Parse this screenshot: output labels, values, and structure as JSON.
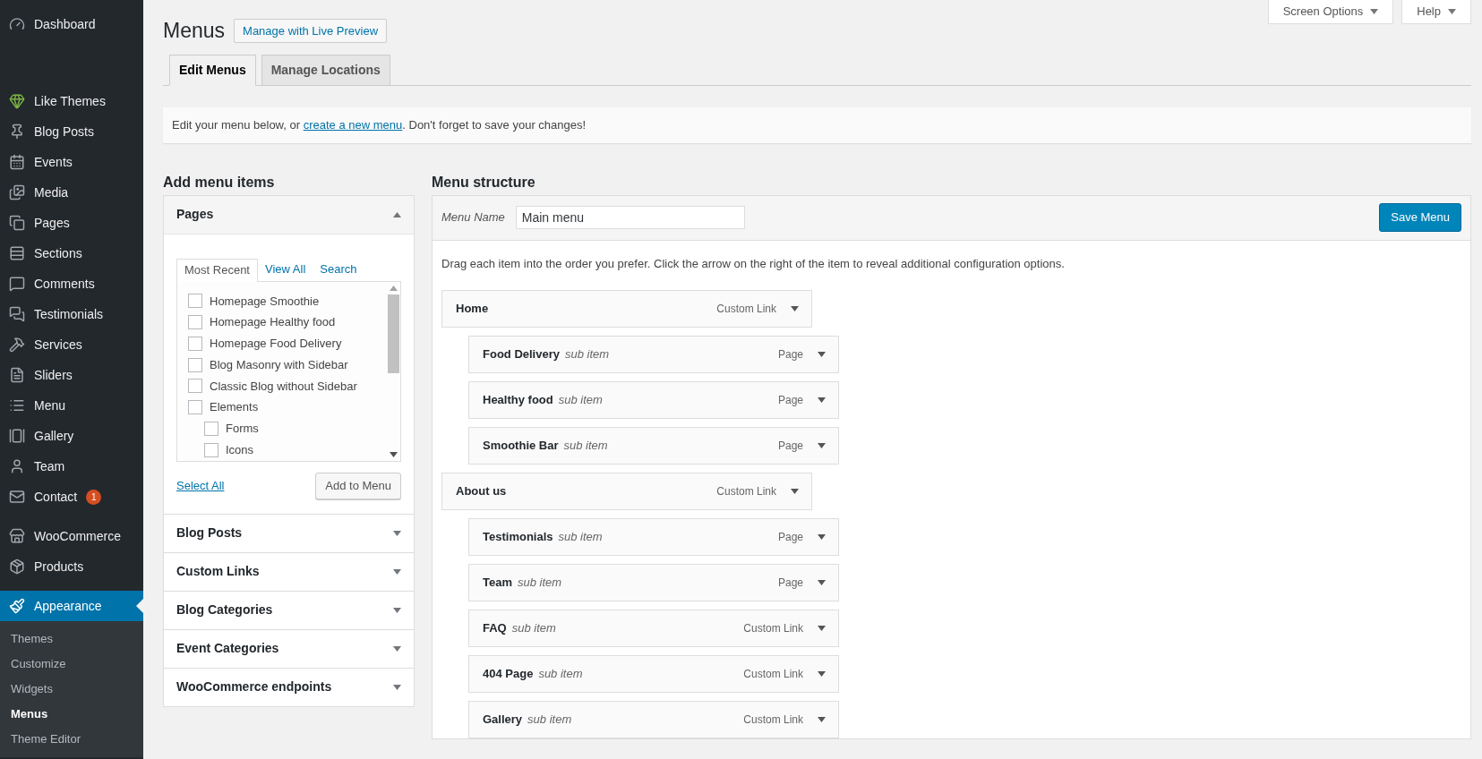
{
  "sidebar": {
    "items": [
      {
        "label": "Dashboard",
        "selected": false
      },
      {
        "label": "Like Themes",
        "selected": false
      },
      {
        "label": "Blog Posts",
        "selected": false
      },
      {
        "label": "Events",
        "selected": false
      },
      {
        "label": "Media",
        "selected": false
      },
      {
        "label": "Pages",
        "selected": false
      },
      {
        "label": "Sections",
        "selected": false
      },
      {
        "label": "Comments",
        "selected": false
      },
      {
        "label": "Testimonials",
        "selected": false
      },
      {
        "label": "Services",
        "selected": false
      },
      {
        "label": "Sliders",
        "selected": false
      },
      {
        "label": "Menu",
        "selected": false
      },
      {
        "label": "Gallery",
        "selected": false
      },
      {
        "label": "Team",
        "selected": false
      },
      {
        "label": "Contact",
        "selected": false,
        "badge": "1"
      },
      {
        "label": "WooCommerce",
        "selected": false
      },
      {
        "label": "Products",
        "selected": false
      },
      {
        "label": "Appearance",
        "selected": true,
        "children": [
          {
            "label": "Themes",
            "selected": false
          },
          {
            "label": "Customize",
            "selected": false
          },
          {
            "label": "Widgets",
            "selected": false
          },
          {
            "label": "Menus",
            "selected": true
          },
          {
            "label": "Theme Editor",
            "selected": false
          }
        ]
      }
    ]
  },
  "header": {
    "title": "Menus",
    "live_preview_button": "Manage with Live Preview",
    "screen_options": "Screen Options",
    "help": "Help"
  },
  "tabs": [
    {
      "label": "Edit Menus",
      "selected": true
    },
    {
      "label": "Manage Locations",
      "selected": false
    }
  ],
  "notice": {
    "before": "Edit your menu below, or ",
    "link": "create a new menu",
    "after": ". Don't forget to save your changes!"
  },
  "add_items": {
    "heading": "Add menu items",
    "panels": [
      {
        "title": "Pages",
        "expanded": true,
        "tabs": [
          {
            "label": "Most Recent",
            "selected": true
          },
          {
            "label": "View All",
            "selected": false
          },
          {
            "label": "Search",
            "selected": false
          }
        ],
        "pages": [
          {
            "label": "Homepage Smoothie",
            "checked": false
          },
          {
            "label": "Homepage Healthy food",
            "checked": false
          },
          {
            "label": "Homepage Food Delivery",
            "checked": false
          },
          {
            "label": "Blog Masonry with Sidebar",
            "checked": false
          },
          {
            "label": "Classic Blog without Sidebar",
            "checked": false
          },
          {
            "label": "Elements",
            "checked": false,
            "children": [
              {
                "label": "Forms",
                "checked": false
              },
              {
                "label": "Icons",
                "checked": false
              }
            ]
          }
        ],
        "select_all": "Select All",
        "add_button": "Add to Menu"
      },
      {
        "title": "Blog Posts",
        "expanded": false
      },
      {
        "title": "Custom Links",
        "expanded": false
      },
      {
        "title": "Blog Categories",
        "expanded": false
      },
      {
        "title": "Event Categories",
        "expanded": false
      },
      {
        "title": "WooCommerce endpoints",
        "expanded": false
      }
    ]
  },
  "menu_structure": {
    "heading": "Menu structure",
    "name_label": "Menu Name",
    "name_value": "Main menu",
    "save_button": "Save Menu",
    "instructions": "Drag each item into the order you prefer. Click the arrow on the right of the item to reveal additional configuration options.",
    "items": [
      {
        "title": "Home",
        "type": "Custom Link",
        "children": [
          {
            "title": "Food Delivery",
            "note": "sub item",
            "type": "Page"
          },
          {
            "title": "Healthy food",
            "note": "sub item",
            "type": "Page"
          },
          {
            "title": "Smoothie Bar",
            "note": "sub item",
            "type": "Page"
          }
        ]
      },
      {
        "title": "About us",
        "type": "Custom Link",
        "children": [
          {
            "title": "Testimonials",
            "note": "sub item",
            "type": "Page"
          },
          {
            "title": "Team",
            "note": "sub item",
            "type": "Page"
          },
          {
            "title": "FAQ",
            "note": "sub item",
            "type": "Custom Link"
          },
          {
            "title": "404 Page",
            "note": "sub item",
            "type": "Custom Link"
          },
          {
            "title": "Gallery",
            "note": "sub item",
            "type": "Custom Link"
          }
        ]
      }
    ]
  }
}
